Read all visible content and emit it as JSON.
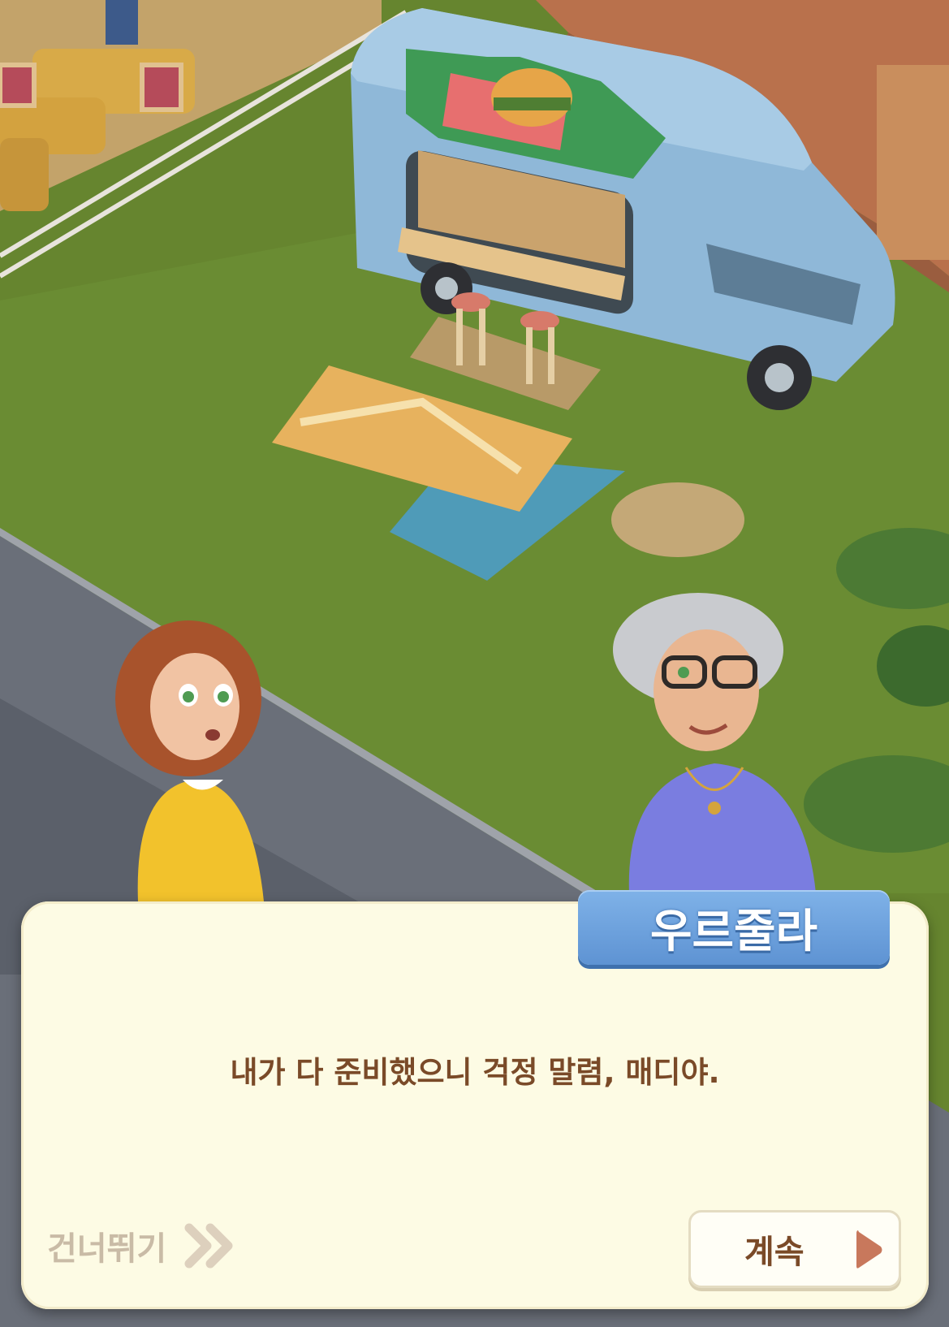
{
  "speaker": {
    "name": "우르줄라"
  },
  "dialogue": {
    "text": "내가 다 준비했으니 걱정 말렴, 매디야."
  },
  "controls": {
    "skip_label": "건너뛰기",
    "continue_label": "계속"
  },
  "colors": {
    "name_tab": "#6aa1dd",
    "dialog_bg": "#fdfbe4",
    "text": "#7a4a28",
    "skip_text": "#c9bba6"
  }
}
